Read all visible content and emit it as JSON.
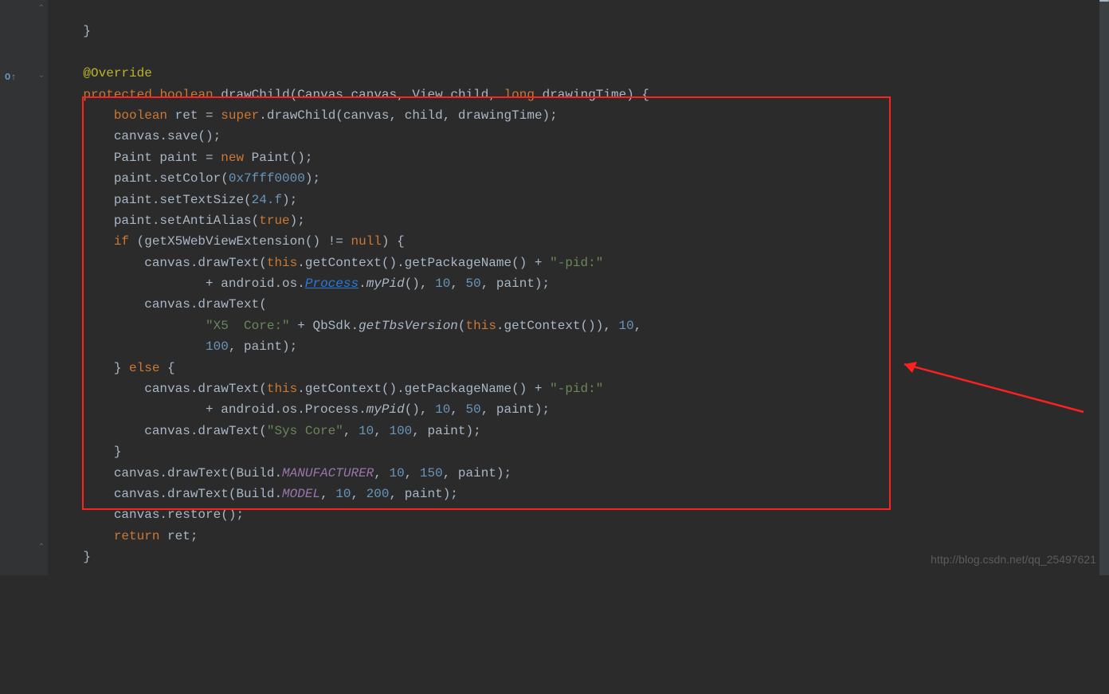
{
  "watermark": "http://blog.csdn.net/qq_25497621",
  "gutter": {
    "override_icon": "O↑",
    "fold_top": "⌃",
    "fold_mid": "⌄",
    "fold_bottom": "⌃"
  },
  "code": {
    "l0": "    }",
    "anno": "@Override",
    "l2_kw1": "protected",
    "l2_kw2": "boolean",
    "l2_method": "drawChild",
    "l2_type1": "Canvas",
    "l2_p1": "canvas",
    "l2_type2": "View",
    "l2_p2": "child",
    "l2_kw3": "long",
    "l2_p3": "drawingTime",
    "l2_brace": ") {",
    "l3_kw": "boolean",
    "l3_var": "ret",
    "l3_eq": " = ",
    "l3_super": "super",
    "l3_call": ".drawChild(canvas, child, drawingTime);",
    "l4": "        canvas.save();",
    "l5_pre": "        Paint paint = ",
    "l5_new": "new",
    "l5_post": " Paint();",
    "l6_pre": "        paint.setColor(",
    "l6_hex": "0x7fff0000",
    "l6_post": ");",
    "l7_pre": "        paint.setTextSize(",
    "l7_num": "24.f",
    "l7_post": ");",
    "l8_pre": "        paint.setAntiAlias(",
    "l8_true": "true",
    "l8_post": ");",
    "l9_if": "if",
    "l9_pre": " (getX5WebViewExtension() != ",
    "l9_null": "null",
    "l9_post": ") {",
    "l10_pre": "            canvas.drawText(",
    "l10_this": "this",
    "l10_mid": ".getContext().getPackageName() + ",
    "l10_str": "\"-pid:\"",
    "l11_pre": "                    + android.os.",
    "l11_link": "Process",
    "l11_dot": ".",
    "l11_ital": "myPid",
    "l11_paren": "(), ",
    "l11_n1": "10",
    "l11_n2": "50",
    "l11_end": ", paint);",
    "l12": "            canvas.drawText(",
    "l13_pre": "                    ",
    "l13_str": "\"X5  Core:\"",
    "l13_mid": " + QbSdk.",
    "l13_ital": "getTbsVersion",
    "l13_paren": "(",
    "l13_this": "this",
    "l13_post": ".getContext()), ",
    "l13_n1": "10",
    "l13_comma": ",",
    "l14_pre": "                    ",
    "l14_n1": "100",
    "l14_post": ", paint);",
    "l15_pre": "        } ",
    "l15_else": "else",
    "l15_post": " {",
    "l16_pre": "            canvas.drawText(",
    "l16_this": "this",
    "l16_mid": ".getContext().getPackageName() + ",
    "l16_str": "\"-pid:\"",
    "l17_pre": "                    + android.os.Process.",
    "l17_ital": "myPid",
    "l17_paren": "(), ",
    "l17_n1": "10",
    "l17_n2": "50",
    "l17_end": ", paint);",
    "l18_pre": "            canvas.drawText(",
    "l18_str": "\"Sys Core\"",
    "l18_mid": ", ",
    "l18_n1": "10",
    "l18_n2": "100",
    "l18_end": ", paint);",
    "l19": "        }",
    "l20_pre": "        canvas.drawText(Build.",
    "l20_field": "MANUFACTURER",
    "l20_mid": ", ",
    "l20_n1": "10",
    "l20_n2": "150",
    "l20_end": ", paint);",
    "l21_pre": "        canvas.drawText(Build.",
    "l21_field": "MODEL",
    "l21_mid": ", ",
    "l21_n1": "10",
    "l21_n2": "200",
    "l21_end": ", paint);",
    "l22": "        canvas.restore();",
    "l23_kw": "return",
    "l23_post": " ret;",
    "l24": "    }"
  }
}
